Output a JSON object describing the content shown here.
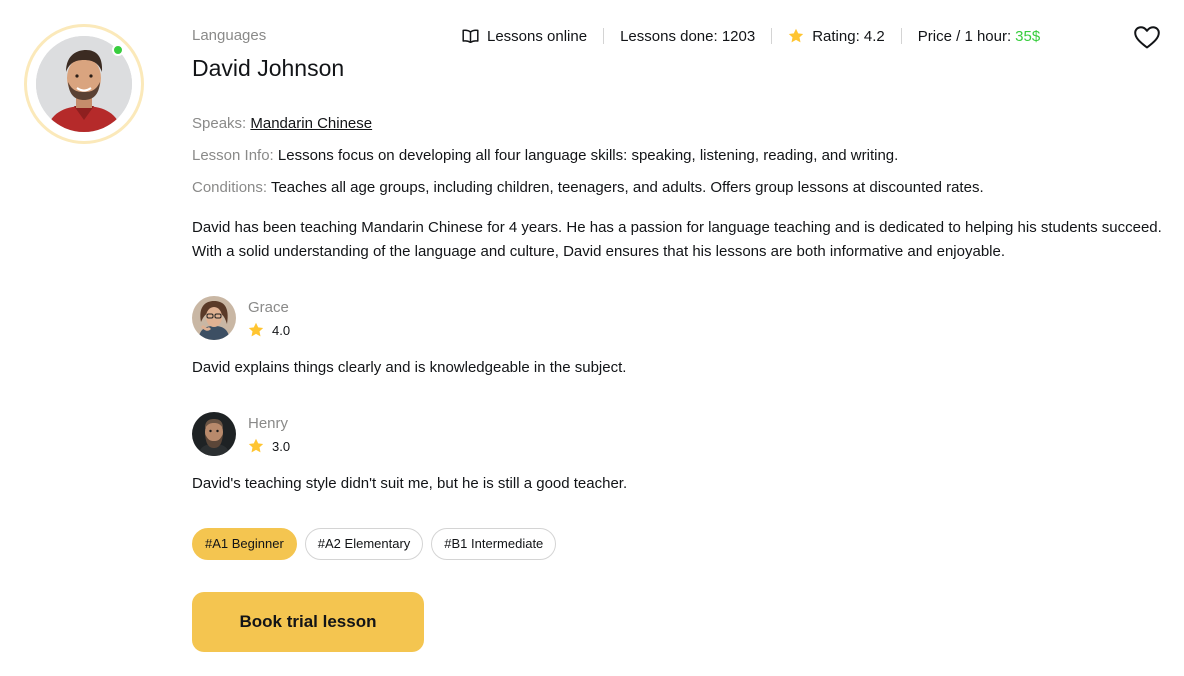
{
  "teacher": {
    "category": "Languages",
    "name": "David Johnson",
    "online": true
  },
  "stats": {
    "lessons_online": "Lessons online",
    "lessons_done_label": "Lessons done:",
    "lessons_done_value": "1203",
    "rating_label": "Rating:",
    "rating_value": "4.2",
    "price_label": "Price / 1 hour:",
    "price_value": "35$"
  },
  "info": {
    "speaks_label": "Speaks:",
    "speaks_value": "Mandarin Chinese",
    "lesson_info_label": "Lesson Info:",
    "lesson_info_value": "Lessons focus on developing all four language skills: speaking, listening, reading, and writing.",
    "conditions_label": "Conditions:",
    "conditions_value": "Teaches all age groups, including children, teenagers, and adults. Offers group lessons at discounted rates."
  },
  "description": "David has been teaching Mandarin Chinese for 4 years. He has a passion for language teaching and is dedicated to helping his students succeed. With a solid understanding of the language and culture, David ensures that his lessons are both informative and enjoyable.",
  "reviews": [
    {
      "name": "Grace",
      "rating": "4.0",
      "text": "David explains things clearly and is knowledgeable in the subject."
    },
    {
      "name": "Henry",
      "rating": "3.0",
      "text": "David's teaching style didn't suit me, but he is still a good teacher."
    }
  ],
  "levels": [
    {
      "label": "#A1 Beginner",
      "active": true
    },
    {
      "label": "#A2 Elementary",
      "active": false
    },
    {
      "label": "#B1 Intermediate",
      "active": false
    }
  ],
  "book_button_label": "Book trial lesson",
  "colors": {
    "accent": "#f4c550",
    "accent_light": "#fbe9ba",
    "online": "#38cd3e",
    "price": "#38cd3e",
    "muted_text": "#8a8a89",
    "text": "#121417",
    "star": "#ffc531"
  },
  "icons": {
    "lessons_online": "open-book-icon",
    "rating": "star-icon",
    "favorite": "heart-outline-icon",
    "review_rating": "star-icon"
  }
}
